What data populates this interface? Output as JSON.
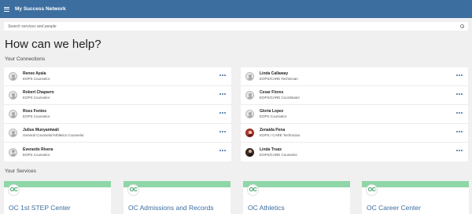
{
  "header": {
    "app_title": "My Success Network",
    "menu_icon": "hamburger-icon"
  },
  "search": {
    "placeholder": "Search services and people",
    "icon": "search-icon"
  },
  "page_title": "How can we help?",
  "connections": {
    "heading": "Your Connections",
    "left": [
      {
        "name": "Renee Ayala",
        "role": "EOPS Counselor",
        "avatar": "default"
      },
      {
        "name": "Robert Chaparro",
        "role": "EOPS Counselor",
        "avatar": "default"
      },
      {
        "name": "Ross Fontes",
        "role": "EOPS Counselor",
        "avatar": "default"
      },
      {
        "name": "Julius Munyantwali",
        "role": "General Counselor/Athletics Counselor",
        "avatar": "default"
      },
      {
        "name": "Everardo Rivera",
        "role": "EOPS Counselor",
        "avatar": "default"
      }
    ],
    "right": [
      {
        "name": "Linda Callaway",
        "role": "EOPS/CARE Technician",
        "avatar": "default"
      },
      {
        "name": "Cesar Flores",
        "role": "EOPS/CARE Coordinator",
        "avatar": "default"
      },
      {
        "name": "Gloria Lopez",
        "role": "EOPS Counselor",
        "avatar": "default"
      },
      {
        "name": "Zenaida Pena",
        "role": "EOPS / CARE Technician",
        "avatar": "photo-red"
      },
      {
        "name": "Linda Truax",
        "role": "EOPS/CARE Counselor",
        "avatar": "photo-dark"
      }
    ]
  },
  "services": {
    "heading": "Your Services",
    "logo_text": "OC",
    "items": [
      {
        "title": "OC 1st STEP Center"
      },
      {
        "title": "OC Admissions and Records"
      },
      {
        "title": "OC Athletics"
      },
      {
        "title": "OC Career Center"
      }
    ]
  },
  "colors": {
    "header_bg": "#3d6ea0",
    "accent": "#3d6ea0",
    "service_band": "#8fd6a8",
    "logo_green": "#3aa164"
  }
}
